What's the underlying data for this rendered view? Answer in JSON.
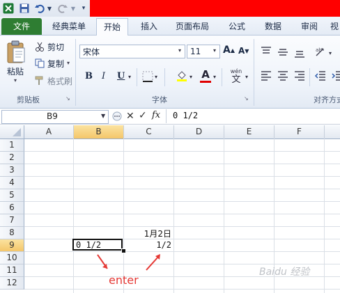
{
  "quick_access": {
    "app_icon": "excel-icon",
    "save_icon": "save-icon",
    "undo_icon": "undo-icon",
    "redo_icon": "redo-icon",
    "customize_icon": "customize-qa-icon"
  },
  "tabs": [
    {
      "label": "文件"
    },
    {
      "label": "经典菜单"
    },
    {
      "label": "开始"
    },
    {
      "label": "插入"
    },
    {
      "label": "页面布局"
    },
    {
      "label": "公式"
    },
    {
      "label": "数据"
    },
    {
      "label": "审阅"
    },
    {
      "label": "视"
    }
  ],
  "ribbon": {
    "clipboard": {
      "paste": "粘贴",
      "cut": "剪切",
      "copy": "复制",
      "format_painter": "格式刷",
      "group_label": "剪贴板"
    },
    "font": {
      "font_name": "宋体",
      "font_size": "11",
      "grow": "A",
      "shrink": "A",
      "bold": "B",
      "italic": "I",
      "underline": "U",
      "font_color_letter": "A",
      "wen": "wén",
      "wen_char": "文",
      "group_label": "字体"
    },
    "alignment": {
      "group_label": "对齐方式"
    }
  },
  "formula_bar": {
    "name_box": "B9",
    "fx": "fx",
    "formula": "0 1/2"
  },
  "grid": {
    "columns": [
      "A",
      "B",
      "C",
      "D",
      "E",
      "F"
    ],
    "rows": [
      "1",
      "2",
      "3",
      "4",
      "5",
      "6",
      "7",
      "8",
      "9",
      "10",
      "11",
      "12"
    ],
    "selected_cell": "B9",
    "cells": {
      "C8": "1月2日",
      "B9": "0 1/2",
      "C9": "1/2"
    }
  },
  "annotation": {
    "text": "enter",
    "color": "#e53935"
  },
  "watermark": "Baidu 经验"
}
